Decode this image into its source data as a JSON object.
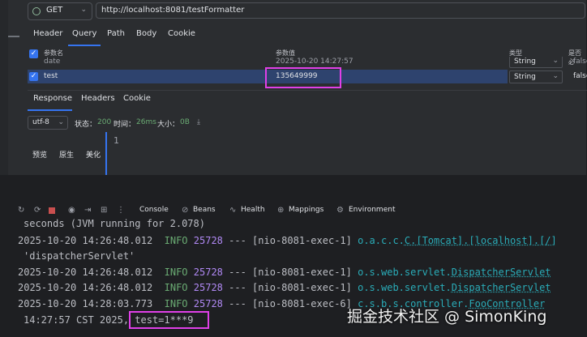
{
  "request": {
    "method": "GET",
    "url": "http://localhost:8081/testFormatter",
    "tabs": [
      "Header",
      "Query",
      "Path",
      "Body",
      "Cookie"
    ],
    "active_tab": "Query",
    "columns": {
      "name": "参数名",
      "value": "参数值",
      "type": "类型",
      "required": "是否必"
    },
    "params": [
      {
        "name": "date",
        "value": "2025-10-20 14:27:57",
        "type": "String",
        "required": "false"
      },
      {
        "name": "test",
        "value": "135649999",
        "type": "String",
        "required": "false"
      }
    ]
  },
  "response": {
    "tabs": [
      "Response",
      "Headers",
      "Cookie"
    ],
    "active_tab": "Response",
    "encoding": "utf-8",
    "status_label": "状态：",
    "status_value": "200",
    "time_label": "时间：",
    "time_value": "26ms",
    "size_label": "大小：",
    "size_value": "0B",
    "view_options": [
      "预览",
      "原生",
      "美化"
    ],
    "line_number": "1"
  },
  "console_toolbar": {
    "items": [
      "Console",
      "Beans",
      "Health",
      "Mappings",
      "Environment"
    ]
  },
  "console_lines": [
    {
      "text": "seconds (JVM running for 2.078)"
    },
    {
      "ts": "2025-10-20 14:26:48.012",
      "level": "INFO",
      "pid": "25728",
      "sep": "---",
      "thread": "[nio-8081-exec-1]",
      "logger_pkg": "o.a.c.c.",
      "logger_cls": "C.[Tomcat].[localhost].[/]"
    },
    {
      "text": "'dispatcherServlet'"
    },
    {
      "ts": "2025-10-20 14:26:48.012",
      "level": "INFO",
      "pid": "25728",
      "sep": "---",
      "thread": "[nio-8081-exec-1]",
      "logger_pkg": "o.s.web.servlet.",
      "logger_cls": "DispatcherServlet"
    },
    {
      "ts": "2025-10-20 14:26:48.012",
      "level": "INFO",
      "pid": "25728",
      "sep": "---",
      "thread": "[nio-8081-exec-1]",
      "logger_pkg": "o.s.web.servlet.",
      "logger_cls": "DispatcherServlet"
    },
    {
      "ts": "2025-10-20 14:28:03.773",
      "level": "INFO",
      "pid": "25728",
      "sep": "---",
      "thread": "[nio-8081-exec-6]",
      "logger_pkg": "c.s.b.s.controller.",
      "logger_cls": "FooController"
    },
    {
      "text": "14:27:57 CST 2025,",
      "highlight": "test=1***9"
    }
  ],
  "watermark": "掘金技术社区 @ SimonKing",
  "colors": {
    "accent": "#3574f0",
    "highlight_box": "#e040e8",
    "info": "#6aab73",
    "pid": "#b189f5",
    "logger": "#2aacb8"
  }
}
